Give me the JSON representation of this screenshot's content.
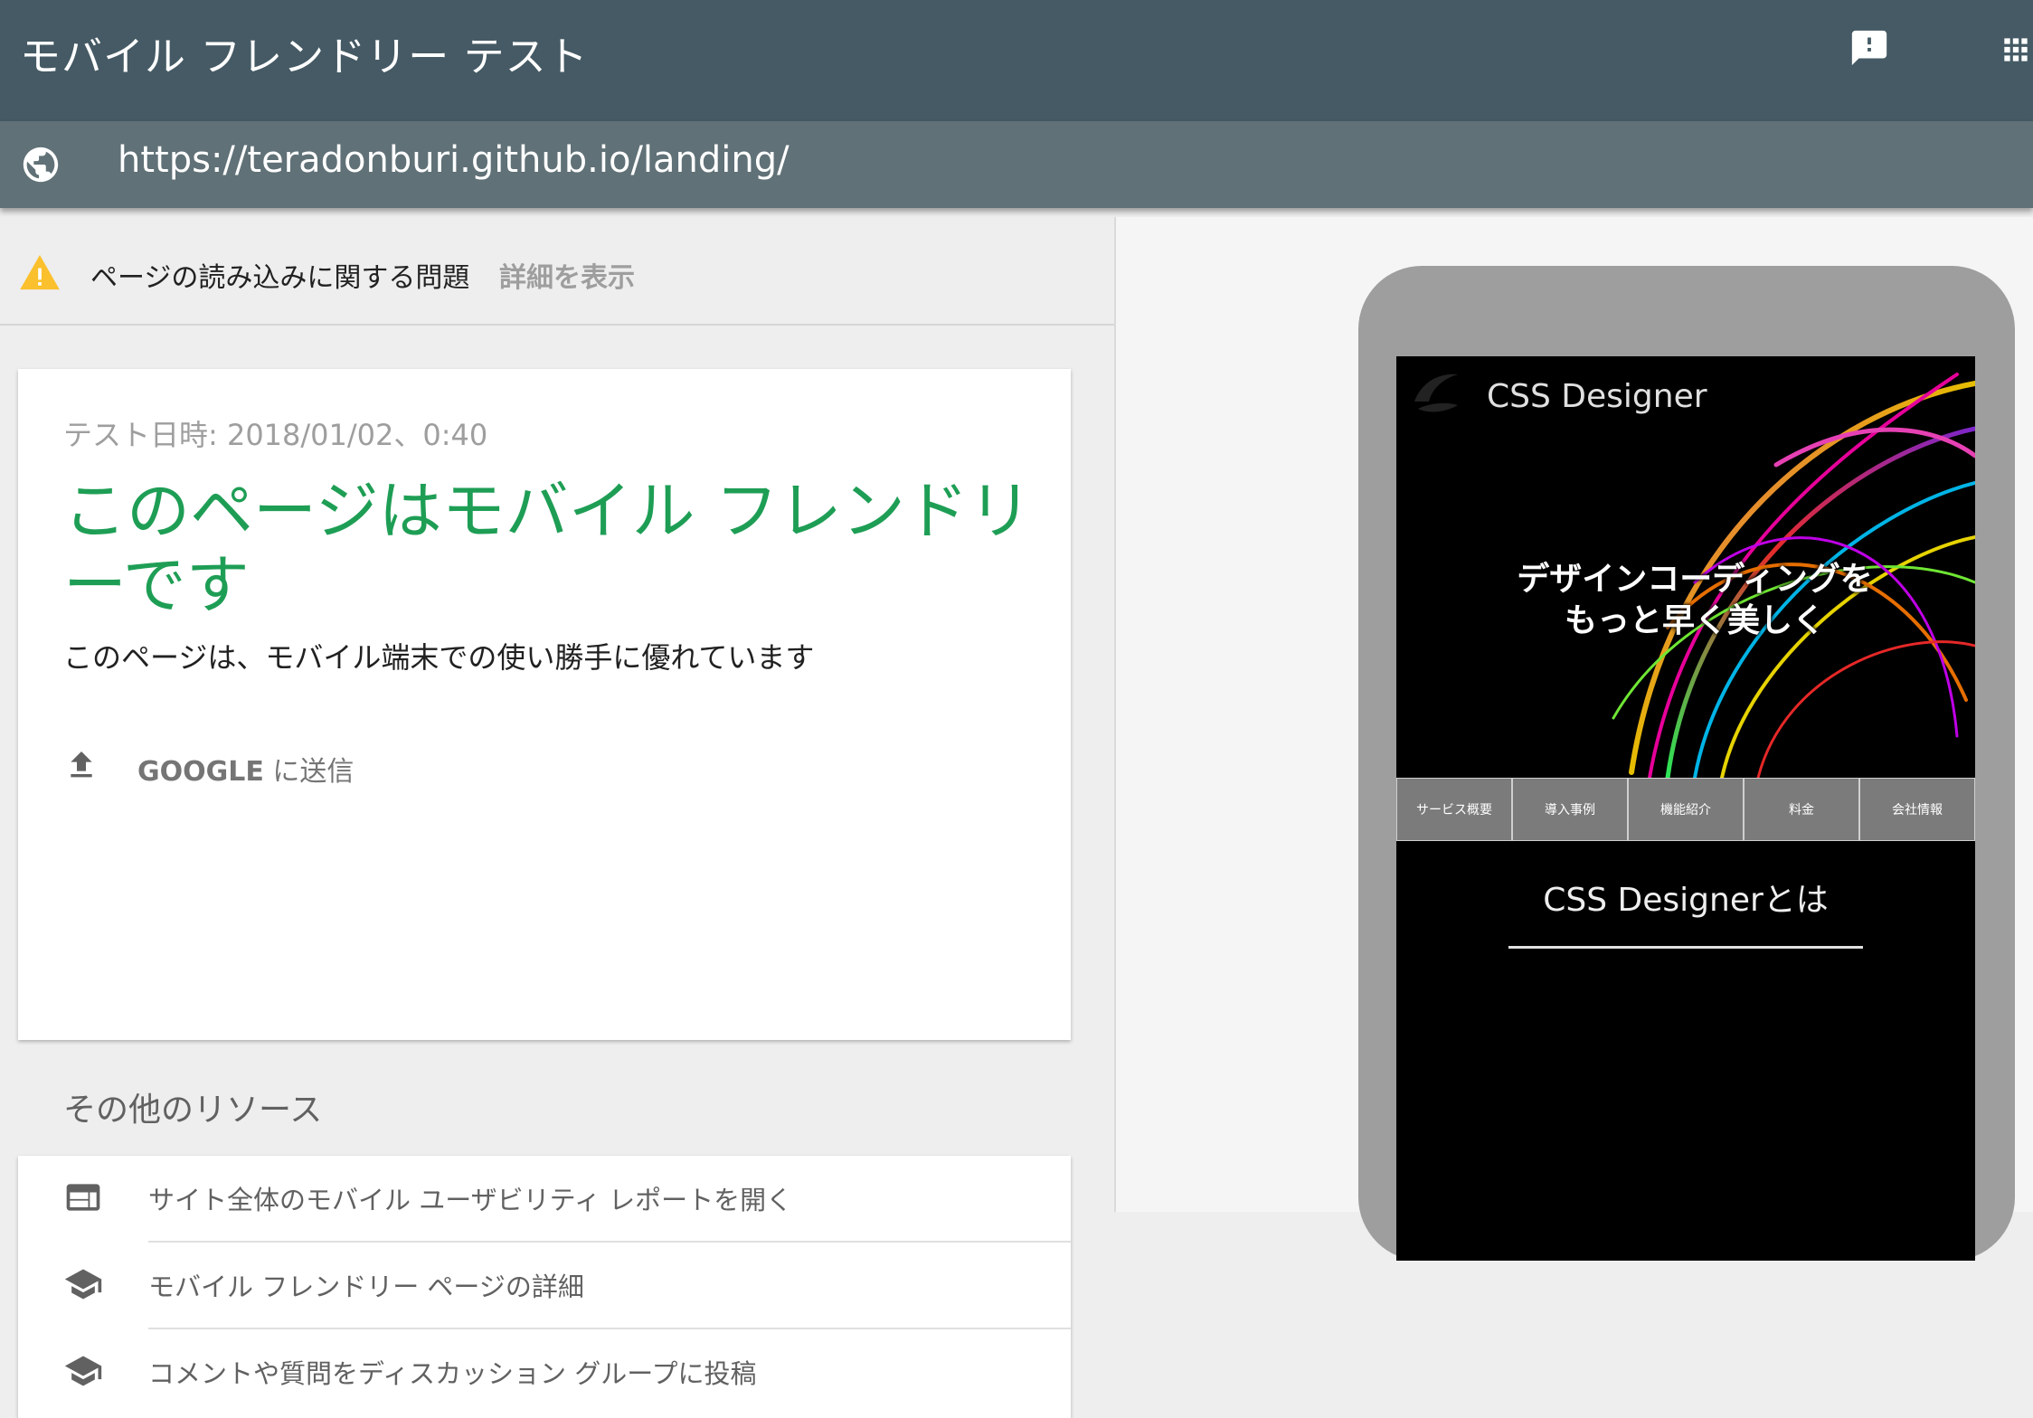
{
  "header": {
    "app_title": "モバイル フレンドリー テスト",
    "feedback_icon": "feedback-icon",
    "apps_icon": "apps-grid-icon",
    "bg_color": "#455a64"
  },
  "url_bar": {
    "icon": "globe-icon",
    "url": "https://teradonburi.github.io/landing/"
  },
  "issue_bar": {
    "icon": "warning-icon",
    "text": "ページの読み込みに関する問題",
    "link": "詳細を表示"
  },
  "result": {
    "test_date": "テスト日時: 2018/01/02、0:40",
    "title": "このページはモバイル フレンドリーです",
    "description": "このページは、モバイル端末での使い勝手に優れています",
    "submit_prefix": "GOOGLE",
    "submit_suffix": " に送信",
    "title_color": "#1e9e55"
  },
  "resources": {
    "heading": "その他のリソース",
    "items": [
      {
        "icon": "web-report-icon",
        "label": "サイト全体のモバイル ユーザビリティ レポートを開く"
      },
      {
        "icon": "school-icon",
        "label": "モバイル フレンドリー ページの詳細"
      },
      {
        "icon": "school-icon",
        "label": "コメントや質問をディスカッション グループに投稿"
      }
    ]
  },
  "preview": {
    "brand": "CSS Designer",
    "tagline_line1": "デザインコーディングを",
    "tagline_line2": "もっと早く美しく",
    "nav": [
      "サービス概要",
      "導入事例",
      "機能紹介",
      "料金",
      "会社情報"
    ],
    "about_heading": "CSS Designerとは"
  }
}
